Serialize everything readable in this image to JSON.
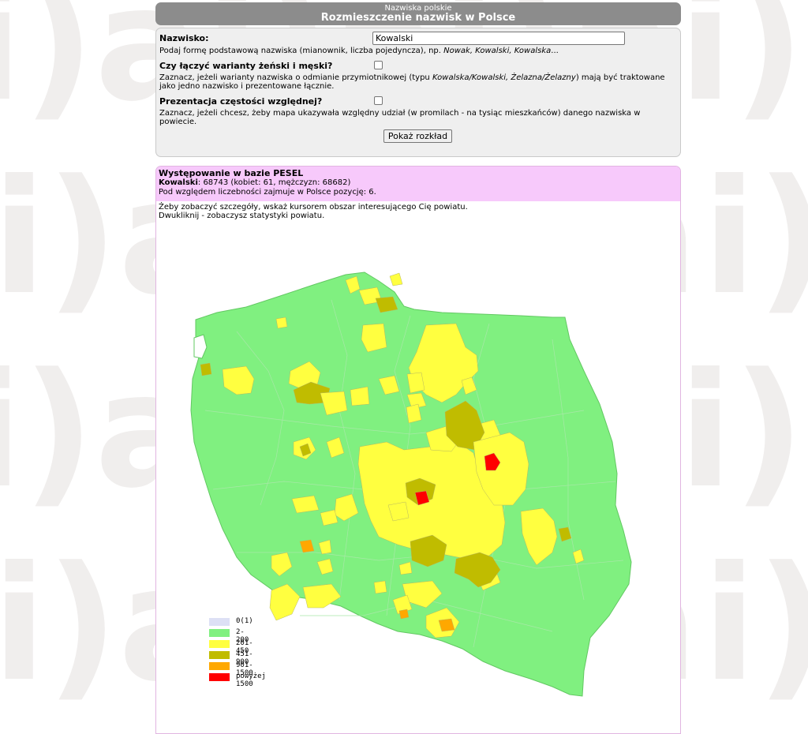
{
  "header": {
    "supertitle": "Nazwiska polskie",
    "title": "Rozmieszczenie nazwisk w Polsce"
  },
  "form": {
    "surname_label": "Nazwisko:",
    "surname_value": "Kowalski",
    "surname_hint_prefix": "Podaj formę podstawową nazwiska (mianownik, liczba pojedyncza), np. ",
    "surname_hint_examples": "Nowak, Kowalski, Kowalska",
    "surname_hint_suffix": "...",
    "merge_label": "Czy łączyć warianty żeński i męski?",
    "merge_checked": false,
    "merge_hint_prefix": "Zaznacz, jeżeli warianty nazwiska o odmianie przymiotnikowej (typu ",
    "merge_hint_examples": "Kowalska/Kowalski, Żelazna/Żelazny",
    "merge_hint_suffix": ") mają być traktowane jako jedno nazwisko i prezentowane łącznie.",
    "relative_label": "Prezentacja częstości względnej?",
    "relative_checked": false,
    "relative_hint": "Zaznacz, jeżeli chcesz, żeby mapa ukazywała względny udział (w promilach - na tysiąc mieszkańców) danego nazwiska w powiecie.",
    "submit_label": "Pokaż rozkład"
  },
  "result": {
    "heading": "Występowanie w bazie PESEL",
    "surname": "Kowalski",
    "counts": ": 68743 (kobiet: 61, mężczyzn: 68682)",
    "rank_text": "Pod względem liczebności zajmuje w Polsce pozycję: 6.",
    "instruction_1": "Żeby zobaczyć szczegóły, wskaż kursorem obszar interesującego Cię powiatu.",
    "instruction_2": "Dwukliknij - zobaczysz statystyki powiatu."
  },
  "legend": [
    {
      "label": "0(1)",
      "color": "#dde0f5"
    },
    {
      "label": "2-200",
      "color": "#80f080"
    },
    {
      "label": "201-450",
      "color": "#ffff40"
    },
    {
      "label": "451-900",
      "color": "#c0bc00"
    },
    {
      "label": "901-1500",
      "color": "#ffa800"
    },
    {
      "label": "powyżej 1500",
      "color": "#ff0000"
    }
  ],
  "map_colors": {
    "base": "#80f080",
    "border": "#6ed36e",
    "district_line": "#a7e8a7"
  },
  "watermark_color": "#f0eeed",
  "watermark_text": "i)a"
}
